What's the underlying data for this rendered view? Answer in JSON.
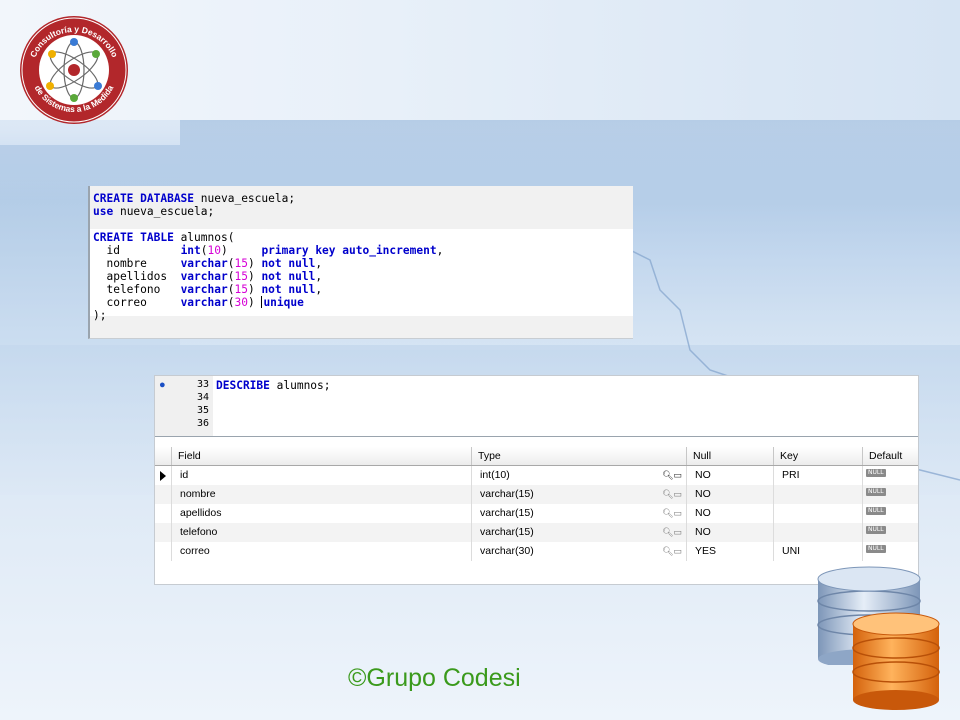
{
  "logo": {
    "text_top": "Consultoría y Desarrollo",
    "text_bottom": "de Sistemas a la Medida"
  },
  "sql_editor": {
    "lines": [
      [
        [
          "kw",
          "CREATE DATABASE"
        ],
        [
          "t",
          " nueva_escuela;"
        ]
      ],
      [
        [
          "kw",
          "use"
        ],
        [
          "t",
          " nueva_escuela;"
        ]
      ],
      [
        [
          "t",
          ""
        ]
      ],
      [
        [
          "kw",
          "CREATE TABLE"
        ],
        [
          "t",
          " alumnos("
        ]
      ],
      [
        [
          "t",
          "  id         "
        ],
        [
          "kw",
          "int"
        ],
        [
          "t",
          "("
        ],
        [
          "num",
          "10"
        ],
        [
          "t",
          ")     "
        ],
        [
          "kw",
          "primary key auto_increment"
        ],
        [
          "t",
          ","
        ]
      ],
      [
        [
          "t",
          "  nombre     "
        ],
        [
          "kw",
          "varchar"
        ],
        [
          "t",
          "("
        ],
        [
          "num",
          "15"
        ],
        [
          "t",
          ") "
        ],
        [
          "kw",
          "not null"
        ],
        [
          "t",
          ","
        ]
      ],
      [
        [
          "t",
          "  apellidos  "
        ],
        [
          "kw",
          "varchar"
        ],
        [
          "t",
          "("
        ],
        [
          "num",
          "15"
        ],
        [
          "t",
          ") "
        ],
        [
          "kw",
          "not null"
        ],
        [
          "t",
          ","
        ]
      ],
      [
        [
          "t",
          "  telefono   "
        ],
        [
          "kw",
          "varchar"
        ],
        [
          "t",
          "("
        ],
        [
          "num",
          "15"
        ],
        [
          "t",
          ") "
        ],
        [
          "kw",
          "not null"
        ],
        [
          "t",
          ","
        ]
      ],
      [
        [
          "t",
          "  correo     "
        ],
        [
          "kw",
          "varchar"
        ],
        [
          "t",
          "("
        ],
        [
          "num",
          "30"
        ],
        [
          "t",
          ") "
        ],
        [
          "caret",
          ""
        ],
        [
          "kw",
          "unique"
        ]
      ],
      [
        [
          "t",
          ");"
        ]
      ]
    ]
  },
  "describe_editor": {
    "line_numbers": [
      "33",
      "34",
      "35",
      "36"
    ],
    "keyword": "DESCRIBE",
    "rest": " alumnos;"
  },
  "result_grid": {
    "columns": [
      "Field",
      "Type",
      "Null",
      "Key",
      "Default"
    ],
    "rows": [
      {
        "field": "id",
        "type": "int(10)",
        "null": "NO",
        "key": "PRI",
        "default": "NULL"
      },
      {
        "field": "nombre",
        "type": "varchar(15)",
        "null": "NO",
        "key": "",
        "default": "NULL"
      },
      {
        "field": "apellidos",
        "type": "varchar(15)",
        "null": "NO",
        "key": "",
        "default": "NULL"
      },
      {
        "field": "telefono",
        "type": "varchar(15)",
        "null": "NO",
        "key": "",
        "default": "NULL"
      },
      {
        "field": "correo",
        "type": "varchar(30)",
        "null": "YES",
        "key": "UNI",
        "default": "NULL"
      }
    ]
  },
  "footer": {
    "copyright": "©Grupo Codesi"
  },
  "colors": {
    "keyword": "#0000cc",
    "number": "#d600d6",
    "copyright": "#3b9a1c"
  }
}
